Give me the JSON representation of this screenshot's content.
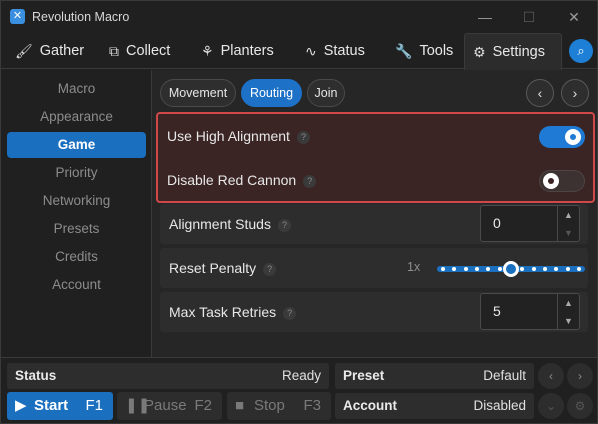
{
  "window": {
    "title": "Revolution Macro",
    "app_icon": "revolution-logo-icon",
    "controls": {
      "minimize": "—",
      "maximize": "☐",
      "close": "✕"
    }
  },
  "tabs": [
    {
      "label": "Gather",
      "icon": "wand-icon",
      "glyph": "🖌"
    },
    {
      "label": "Collect",
      "icon": "collect-icon",
      "glyph": "⧉"
    },
    {
      "label": "Planters",
      "icon": "planter-icon",
      "glyph": "⚘"
    },
    {
      "label": "Status",
      "icon": "pulse-icon",
      "glyph": "∿"
    },
    {
      "label": "Tools",
      "icon": "wrench-icon",
      "glyph": "🔧"
    },
    {
      "label": "Settings",
      "icon": "gear-icon",
      "glyph": "⚙",
      "active": true
    }
  ],
  "search_icon": "search-icon",
  "sidebar": {
    "items": [
      "Macro",
      "Appearance",
      "Game",
      "Priority",
      "Networking",
      "Presets",
      "Credits",
      "Account"
    ],
    "active": "Game"
  },
  "subtabs": {
    "items": [
      "Movement",
      "Routing",
      "Join"
    ],
    "active": "Routing",
    "prev": "‹",
    "next": "›"
  },
  "settings": {
    "use_high_alignment": {
      "label": "Use High Alignment",
      "help": "?",
      "value": true
    },
    "disable_red_cannon": {
      "label": "Disable Red Cannon",
      "help": "?",
      "value": false
    },
    "alignment_studs": {
      "label": "Alignment Studs",
      "help": "?",
      "value": "0"
    },
    "reset_penalty": {
      "label": "Reset Penalty",
      "help": "?",
      "value": "1x",
      "level": 0.5,
      "steps": 13
    },
    "max_task_retries": {
      "label": "Max Task Retries",
      "help": "?",
      "value": "5"
    }
  },
  "bottom": {
    "status": {
      "label": "Status",
      "value": "Ready"
    },
    "preset": {
      "label": "Preset",
      "value": "Default"
    },
    "account": {
      "label": "Account",
      "value": "Disabled"
    },
    "start": {
      "label": "Start",
      "key": "F1",
      "icon": "play-icon"
    },
    "pause": {
      "label": "Pause",
      "key": "F2",
      "icon": "pause-icon"
    },
    "stop": {
      "label": "Stop",
      "key": "F3",
      "icon": "stop-icon"
    }
  },
  "colors": {
    "accent": "#1a6fbf",
    "highlight_border": "#d04848",
    "background": "#202020"
  }
}
